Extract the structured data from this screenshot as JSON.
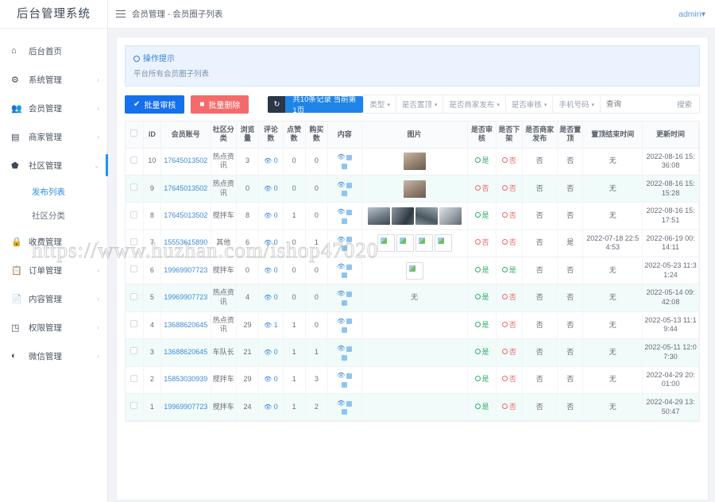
{
  "sidebar": {
    "logo": "后台管理系统",
    "items": [
      {
        "label": "后台首页",
        "icon": "home-icon",
        "arrow": ""
      },
      {
        "label": "系统管理",
        "icon": "gear-icon",
        "arrow": "›"
      },
      {
        "label": "会员管理",
        "icon": "users-icon",
        "arrow": "›"
      },
      {
        "label": "商家管理",
        "icon": "shop-icon",
        "arrow": "›"
      },
      {
        "label": "社区管理",
        "icon": "shield-icon",
        "arrow": "⌄"
      },
      {
        "label": "收费管理",
        "icon": "lock-icon",
        "arrow": "›"
      },
      {
        "label": "订单管理",
        "icon": "clipboard-icon",
        "arrow": "›"
      },
      {
        "label": "内容管理",
        "icon": "file-icon",
        "arrow": "›"
      },
      {
        "label": "权限管理",
        "icon": "key-icon",
        "arrow": "›"
      },
      {
        "label": "微信管理",
        "icon": "wechat-icon",
        "arrow": "›"
      }
    ],
    "subitems": [
      {
        "label": "发布列表",
        "active": true
      },
      {
        "label": "社区分类",
        "active": false
      }
    ]
  },
  "topbar": {
    "breadcrumb": "会员管理 - 会员圈子列表",
    "user": "admin",
    "user_caret": "▾"
  },
  "tip": {
    "title": "操作提示",
    "text": "平台所有会员圈子列表"
  },
  "toolbar": {
    "batch_audit": "批量审核",
    "batch_delete": "批量删除",
    "refresh_icon": "↻",
    "count_text": "共10条记录 当前第1页",
    "filters": [
      {
        "label": "类型",
        "caret": "▾"
      },
      {
        "label": "是否置顶",
        "caret": "▾"
      },
      {
        "label": "是否商家发布",
        "caret": "▾"
      },
      {
        "label": "是否审核",
        "caret": "▾"
      },
      {
        "label": "手机号码",
        "caret": "▾"
      }
    ],
    "search_placeholder": "查询",
    "search_button": "搜索"
  },
  "table": {
    "headers": [
      "",
      "ID",
      "会员账号",
      "社区分类",
      "浏览量",
      "评论数",
      "点赞数",
      "购买数",
      "内容",
      "图片",
      "是否审核",
      "是否下架",
      "是否商家发布",
      "是否置顶",
      "置顶结束时间",
      "更新时间"
    ],
    "row_actions": {
      "view": "查看",
      "top": "置顶"
    },
    "rows": [
      {
        "id": "10",
        "account": "17645013502",
        "category": "热点资讯",
        "views": "3",
        "comments": "0",
        "likes": "0",
        "buys": "0",
        "audited": "是",
        "audited_state": "yes",
        "offshelf": "否",
        "offshelf_state": "no",
        "merchant": "否",
        "pinned": "否",
        "pin_end": "无",
        "updated": "2022-08-16 15:36:08",
        "images": [
          {
            "kind": "photo",
            "style": "photo-a"
          }
        ]
      },
      {
        "id": "9",
        "account": "17645013502",
        "category": "热点资讯",
        "views": "0",
        "comments": "0",
        "likes": "0",
        "buys": "0",
        "audited": "否",
        "audited_state": "no",
        "offshelf": "否",
        "offshelf_state": "no",
        "merchant": "否",
        "pinned": "否",
        "pin_end": "无",
        "updated": "2022-08-16 15:15:28",
        "images": [
          {
            "kind": "photo",
            "style": "photo-a"
          }
        ]
      },
      {
        "id": "8",
        "account": "17645013502",
        "category": "搅拌车",
        "views": "8",
        "comments": "0",
        "likes": "1",
        "buys": "0",
        "audited": "是",
        "audited_state": "yes",
        "offshelf": "否",
        "offshelf_state": "no",
        "merchant": "否",
        "pinned": "否",
        "pin_end": "无",
        "updated": "2022-08-16 15:17:51",
        "images": [
          {
            "kind": "photo",
            "style": "photo-b"
          },
          {
            "kind": "photo",
            "style": "photo-c"
          },
          {
            "kind": "photo",
            "style": "photo-d"
          },
          {
            "kind": "photo",
            "style": "photo-e"
          }
        ]
      },
      {
        "id": "7",
        "account": "15553615890",
        "category": "其他",
        "views": "6",
        "comments": "0",
        "likes": "0",
        "buys": "1",
        "audited": "否",
        "audited_state": "no",
        "offshelf": "否",
        "offshelf_state": "no",
        "merchant": "否",
        "pinned": "是",
        "pin_end": "2022-07-18 22:54:53",
        "updated": "2022-06-19 00:14:11",
        "images": [
          {
            "kind": "broken"
          },
          {
            "kind": "broken"
          },
          {
            "kind": "broken"
          },
          {
            "kind": "broken"
          }
        ]
      },
      {
        "id": "6",
        "account": "19969907723",
        "category": "搅拌车",
        "views": "0",
        "comments": "0",
        "likes": "0",
        "buys": "0",
        "audited": "是",
        "audited_state": "yes",
        "offshelf": "是",
        "offshelf_state": "yes",
        "merchant": "否",
        "pinned": "否",
        "pin_end": "无",
        "updated": "2022-05-23 11:31:24",
        "images": [
          {
            "kind": "broken"
          }
        ]
      },
      {
        "id": "5",
        "account": "19969907723",
        "category": "热点资讯",
        "views": "4",
        "comments": "0",
        "likes": "0",
        "buys": "0",
        "audited": "是",
        "audited_state": "yes",
        "offshelf": "否",
        "offshelf_state": "no",
        "merchant": "否",
        "pinned": "否",
        "pin_end": "无",
        "updated": "2022-05-14 09:42:08",
        "images": [],
        "images_none": "无"
      },
      {
        "id": "4",
        "account": "13688620645",
        "category": "热点资讯",
        "views": "29",
        "comments": "1",
        "likes": "1",
        "buys": "0",
        "audited": "是",
        "audited_state": "yes",
        "offshelf": "否",
        "offshelf_state": "no",
        "merchant": "否",
        "pinned": "否",
        "pin_end": "无",
        "updated": "2022-05-13 11:19:44",
        "images": []
      },
      {
        "id": "3",
        "account": "13688620645",
        "category": "车队长",
        "views": "21",
        "comments": "0",
        "likes": "1",
        "buys": "1",
        "audited": "是",
        "audited_state": "yes",
        "offshelf": "否",
        "offshelf_state": "no",
        "merchant": "否",
        "pinned": "否",
        "pin_end": "无",
        "updated": "2022-05-11 12:07:30",
        "images": []
      },
      {
        "id": "2",
        "account": "15853030939",
        "category": "搅拌车",
        "views": "29",
        "comments": "0",
        "likes": "1",
        "buys": "3",
        "audited": "是",
        "audited_state": "yes",
        "offshelf": "否",
        "offshelf_state": "no",
        "merchant": "否",
        "pinned": "否",
        "pin_end": "无",
        "updated": "2022-04-29 20:01:00",
        "images": []
      },
      {
        "id": "1",
        "account": "19969907723",
        "category": "搅拌车",
        "views": "24",
        "comments": "0",
        "likes": "1",
        "buys": "2",
        "audited": "是",
        "audited_state": "yes",
        "offshelf": "否",
        "offshelf_state": "no",
        "merchant": "否",
        "pinned": "否",
        "pin_end": "无",
        "updated": "2022-04-29 13:50:47",
        "images": []
      }
    ]
  },
  "watermark": "https://www.huzhan.com/ishop47020",
  "colors": {
    "primary": "#1570ef",
    "danger": "#f46b6b",
    "accent": "#1f84e8",
    "yes": "#2fae6a",
    "no": "#e96a6a"
  }
}
